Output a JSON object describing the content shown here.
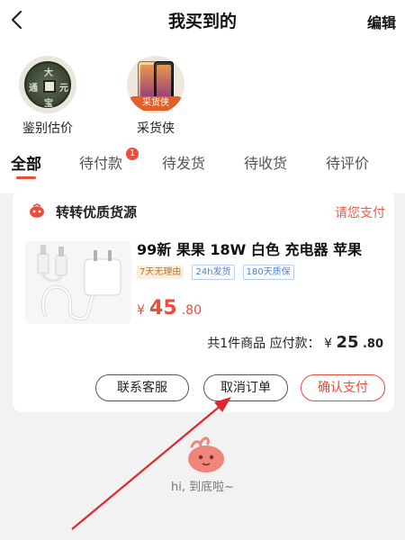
{
  "nav": {
    "title": "我买到的",
    "edit": "编辑"
  },
  "quick": [
    {
      "label": "鉴别估价"
    },
    {
      "label": "采货侠",
      "badge": "采货侠"
    }
  ],
  "tabs": [
    {
      "label": "全部"
    },
    {
      "label": "待付款",
      "badge": "1"
    },
    {
      "label": "待发货"
    },
    {
      "label": "待收货"
    },
    {
      "label": "待评价"
    }
  ],
  "order": {
    "shop_name": "转转优质货源",
    "status": "请您支付",
    "product_title": "99新 果果 18W 白色 充电器 苹果",
    "tags": [
      "7天无理由",
      "24h发货",
      "180天质保"
    ],
    "price": {
      "currency": "¥",
      "int": "45",
      "dec": ".80"
    },
    "summary": {
      "prefix": "共1件商品 应付款：",
      "currency": "¥",
      "int": "25",
      "dec": ".80"
    },
    "buttons": {
      "contact": "联系客服",
      "cancel": "取消订单",
      "confirm": "确认支付"
    }
  },
  "footer": {
    "text": "hi, 到底啦~"
  },
  "colors": {
    "accent": "#e84a3b",
    "background": "#f2f2f2",
    "annotation_arrow": "#e3262e"
  }
}
